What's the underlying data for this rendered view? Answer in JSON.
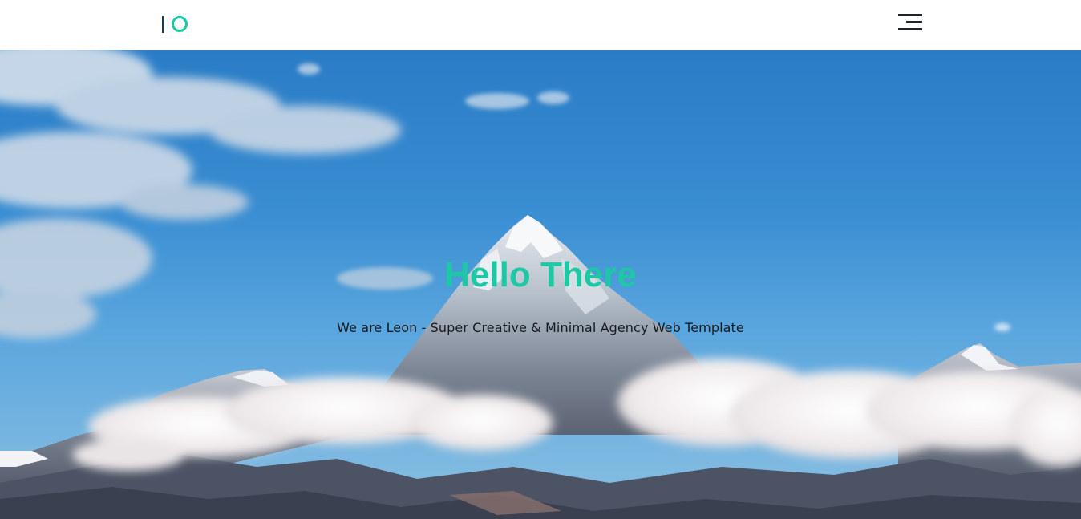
{
  "header": {
    "logo_icon": "io-logo",
    "menu_icon": "hamburger-menu-icon",
    "background_color": "#ffffff"
  },
  "hero": {
    "title": "Hello There",
    "subtitle": "We are Leon - Super Creative & Minimal Agency Web Template",
    "title_color": "#1dc8a4",
    "subtitle_color": "#161a1f",
    "background_image": "snow-capped-mountain-peak-with-clouds"
  }
}
